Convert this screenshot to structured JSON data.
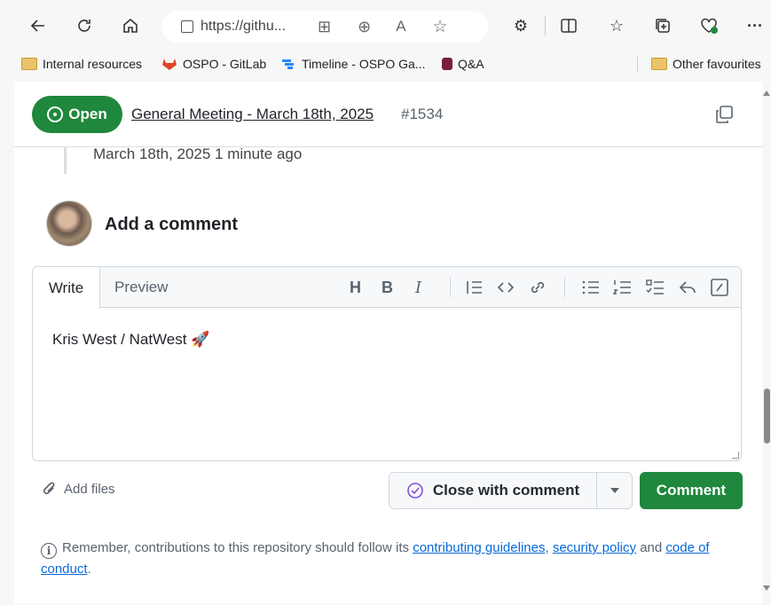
{
  "browser": {
    "url": "https://githu...",
    "bookmarks": [
      {
        "label": "Internal resources",
        "icon": "folder-icon"
      },
      {
        "label": "OSPO - GitLab",
        "icon": "gitlab-icon"
      },
      {
        "label": "Timeline - OSPO Ga...",
        "icon": "jira-icon"
      },
      {
        "label": "Q&A",
        "icon": "qa-icon"
      }
    ],
    "other_favourites": "Other favourites"
  },
  "issue": {
    "state": "Open",
    "title": "General Meeting - March 18th, 2025",
    "number": "#1534"
  },
  "timeline": {
    "timestamp": "March 18th, 2025 1 minute ago"
  },
  "comment_box": {
    "heading": "Add a comment",
    "tabs": {
      "write": "Write",
      "preview": "Preview"
    },
    "toolbar": [
      "heading",
      "bold",
      "italic",
      "quote",
      "code",
      "link",
      "unordered-list",
      "ordered-list",
      "task-list",
      "reply",
      "slash-commands"
    ],
    "text": "Kris West / NatWest 🚀",
    "add_files": "Add files",
    "close_label": "Close with comment",
    "submit_label": "Comment"
  },
  "footer_note": {
    "prefix": "Remember, contributions to this repository should follow its",
    "link1": "contributing guidelines",
    "sep": ",",
    "link2": "security policy",
    "and": "and",
    "link3": "code of conduct",
    "suffix": "."
  },
  "colors": {
    "green": "#1f883d",
    "link": "#0969da",
    "muted": "#59636e"
  }
}
